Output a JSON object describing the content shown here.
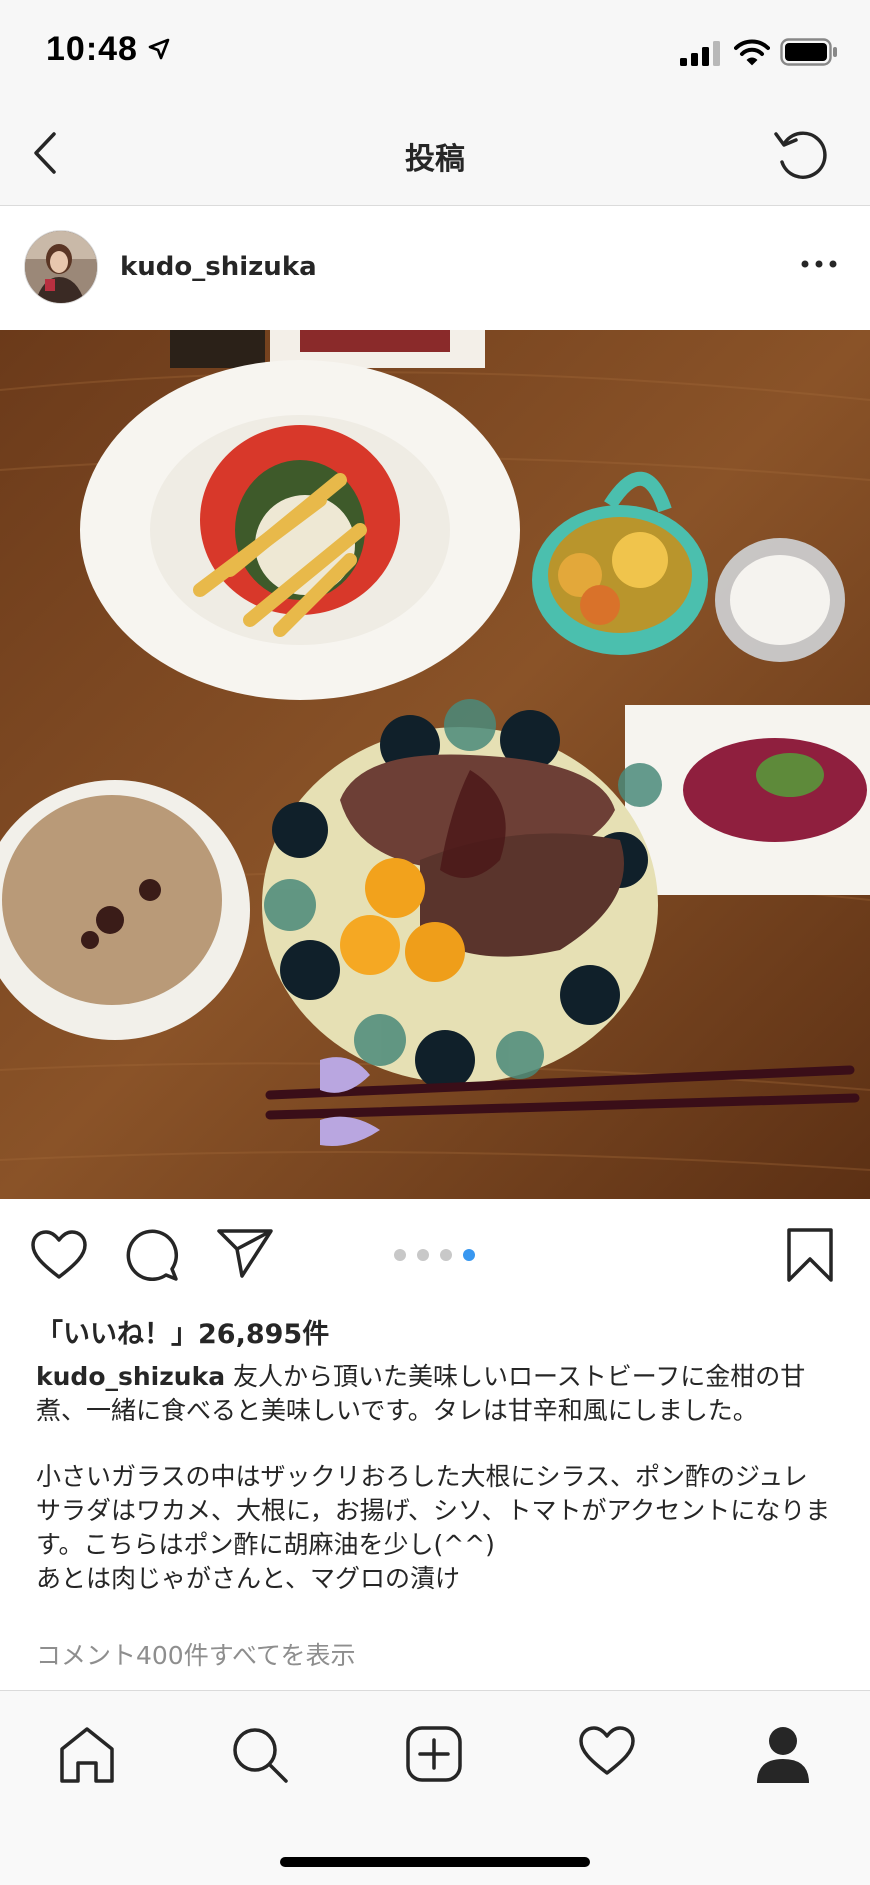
{
  "status": {
    "time": "10:48"
  },
  "nav": {
    "title": "投稿"
  },
  "post": {
    "username": "kudo_shizuka",
    "carousel": {
      "total": 4,
      "active_index": 3
    },
    "likes_text": "「いいね！」26,895件",
    "caption": {
      "username": "kudo_shizuka",
      "line1": "友人から頂いた美味しいローストビーフに金柑の甘煮、一緒に食べると美味しいです。タレは甘辛和風にしました。",
      "line2": "小さいガラスの中はザックリおろした大根にシラス、ポン酢のジュレ",
      "line3": "サラダはワカメ、大根に，お揚げ、シソ、トマトがアクセントになります。こちらはポン酢に胡麻油を少し(^^)",
      "line4": "あとは肉じゃがさんと、マグロの漬け"
    },
    "comments_link": "コメント400件すべてを表示"
  },
  "icons": {
    "nav": [
      "back-chevron-icon",
      "refresh-icon"
    ],
    "post": [
      "more-options-icon"
    ],
    "actions": [
      "heart-icon",
      "comment-icon",
      "share-icon",
      "bookmark-icon"
    ],
    "tabs": [
      "home-icon",
      "search-icon",
      "add-post-icon",
      "activity-heart-icon",
      "profile-icon"
    ]
  },
  "colors": {
    "active_dot": "#3897f0",
    "inactive_dot": "#c8c8c8",
    "text": "#262626",
    "muted": "#8e8e8e"
  }
}
